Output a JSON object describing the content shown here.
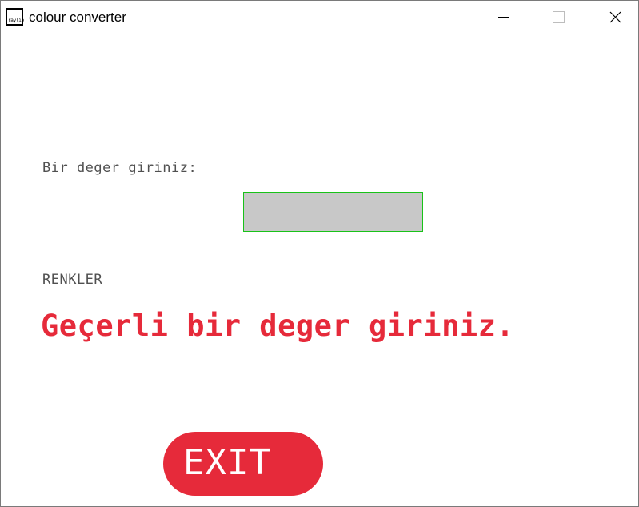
{
  "window": {
    "title": "colour converter",
    "icon": "raylib-icon",
    "icon_text": "raylib",
    "controls": {
      "minimize": "minimize-icon",
      "maximize": "maximize-icon",
      "close": "close-icon"
    }
  },
  "main": {
    "prompt_label": "Bir deger giriniz:",
    "input": {
      "value": "",
      "fill_color": "#c8c8c8",
      "border_color": "#19c219"
    },
    "colors_label": "RENKLER",
    "error_message": "Geçerli bir deger giriniz.",
    "exit_label": "EXIT"
  },
  "colors": {
    "text": "#505050",
    "accent_red": "#e62a3a",
    "background": "#ffffff"
  }
}
